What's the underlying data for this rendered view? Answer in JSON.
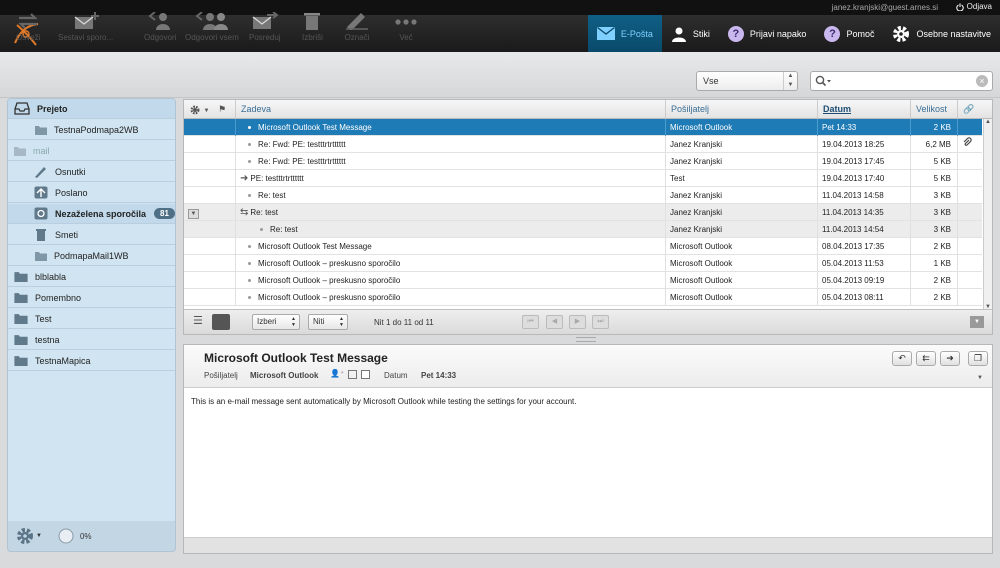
{
  "topbar": {
    "user": "janez.kranjski@guest.arnes.si",
    "logout": "Odjava"
  },
  "nav": [
    {
      "label": "E-Pošta",
      "icon": "mail-icon",
      "active": true
    },
    {
      "label": "Stiki",
      "icon": "contacts-icon"
    },
    {
      "label": "Prijavi napako",
      "icon": "help-icon"
    },
    {
      "label": "Pomoč",
      "icon": "help-icon"
    },
    {
      "label": "Osebne nastavitve",
      "icon": "gear-icon"
    }
  ],
  "toolbar": {
    "refresh": "Osveži",
    "compose": "Sestavi sporo...",
    "reply": "Odgovori",
    "reply_all": "Odgovori vsem",
    "forward": "Posreduj",
    "delete": "Izbriši",
    "mark": "Označi",
    "more": "Več",
    "filter": "Vse",
    "search_placeholder": ""
  },
  "sidebar": {
    "items": [
      {
        "label": "Prejeto",
        "selected": true
      },
      {
        "label": "TestnaPodmapa2WB"
      },
      {
        "label": "mail"
      },
      {
        "label": "Osnutki"
      },
      {
        "label": "Poslano"
      },
      {
        "label": "Nezaželena sporočila",
        "badge": "81"
      },
      {
        "label": "Smeti"
      },
      {
        "label": "PodmapaMail1WB"
      },
      {
        "label": "blblabla"
      },
      {
        "label": "Pomembno"
      },
      {
        "label": "Test"
      },
      {
        "label": "testna"
      },
      {
        "label": "TestnaMapica"
      }
    ],
    "quota": "0%"
  },
  "list": {
    "columns": {
      "subject": "Zadeva",
      "from": "Pošiljatelj",
      "date": "Datum",
      "size": "Velikost"
    },
    "rows": [
      {
        "subject": "Microsoft Outlook Test Message",
        "from": "Microsoft Outlook",
        "date": "Pet 14:33",
        "size": "2 KB"
      },
      {
        "subject": "Re: Fwd: PE: testttrtrtttttt",
        "from": "Janez Kranjski",
        "date": "19.04.2013 18:25",
        "size": "6,2 MB"
      },
      {
        "subject": "Re: Fwd: PE: testttrtrtttttt",
        "from": "Janez Kranjski",
        "date": "19.04.2013 17:45",
        "size": "5 KB"
      },
      {
        "subject": "PE: testttrtrtttttt",
        "from": "Test",
        "date": "19.04.2013 17:40",
        "size": "5 KB"
      },
      {
        "subject": "Re: test",
        "from": "Janez Kranjski",
        "date": "11.04.2013 14:58",
        "size": "3 KB"
      },
      {
        "subject": "Re: test",
        "from": "Janez Kranjski",
        "date": "11.04.2013 14:35",
        "size": "3 KB"
      },
      {
        "subject": "Re: test",
        "from": "Janez Kranjski",
        "date": "11.04.2013 14:54",
        "size": "3 KB"
      },
      {
        "subject": "Microsoft Outlook Test Message",
        "from": "Microsoft Outlook",
        "date": "08.04.2013 17:35",
        "size": "2 KB"
      },
      {
        "subject": "Microsoft Outlook – preskusno sporočilo",
        "from": "Microsoft Outlook",
        "date": "05.04.2013 11:53",
        "size": "1 KB"
      },
      {
        "subject": "Microsoft Outlook – preskusno sporočilo",
        "from": "Microsoft Outlook",
        "date": "05.04.2013 09:19",
        "size": "2 KB"
      },
      {
        "subject": "Microsoft Outlook – preskusno sporočilo",
        "from": "Microsoft Outlook",
        "date": "05.04.2013 08:11",
        "size": "2 KB"
      }
    ],
    "footer": {
      "select": "Izberi",
      "threads": "Niti",
      "count": "Nit 1 do 11 od 11"
    }
  },
  "preview": {
    "subject": "Microsoft Outlook Test Message",
    "from_label": "Pošiljatelj",
    "from": "Microsoft Outlook",
    "date_label": "Datum",
    "date": "Pet 14:33",
    "body": "This is an e-mail message sent automatically by Microsoft Outlook while testing the settings for your account."
  },
  "colors": {
    "accent": "#1f7bb5",
    "sidebar": "#d0e4f1"
  }
}
